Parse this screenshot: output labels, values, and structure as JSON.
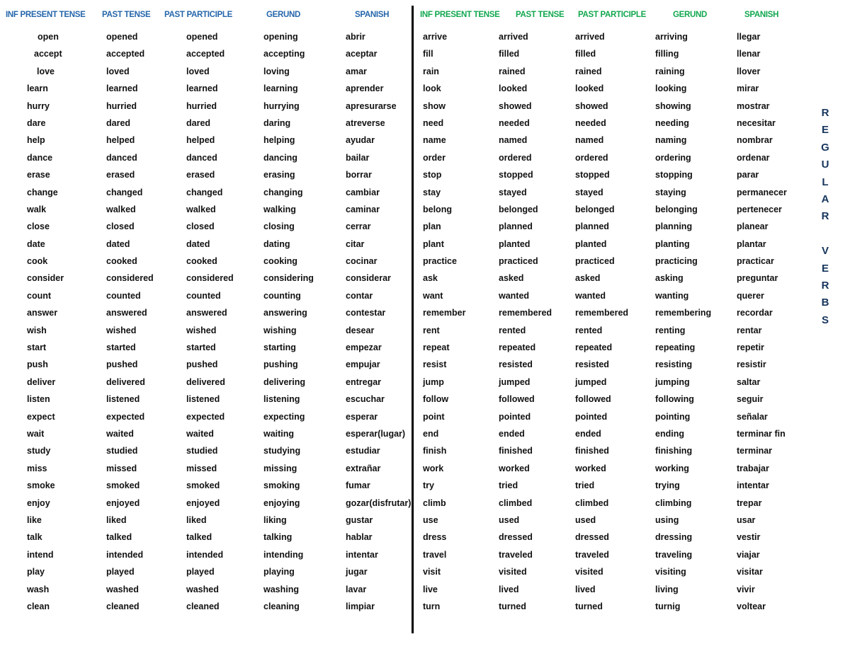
{
  "side_title": {
    "name": "regular-verbs-vertical-title",
    "letters": [
      "R",
      "E",
      "G",
      "U",
      "L",
      "A",
      "R",
      "",
      "V",
      "E",
      "R",
      "B",
      "S"
    ]
  },
  "colors": {
    "left_header": "#2566ab",
    "right_header": "#12a84f",
    "side_title": "#17365d",
    "body_text": "#111111",
    "divider": "#000000",
    "background": "#ffffff"
  },
  "left_table": {
    "headers": [
      "INF PRESENT TENSE",
      "PAST TENSE",
      "PAST PARTICIPLE",
      "GERUND",
      "SPANISH"
    ],
    "rows": [
      [
        "open",
        "opened",
        "opened",
        "opening",
        "abrir"
      ],
      [
        "accept",
        "accepted",
        "accepted",
        "accepting",
        "aceptar"
      ],
      [
        "love",
        "loved",
        "loved",
        "loving",
        "amar"
      ],
      [
        "learn",
        "learned",
        "learned",
        "learning",
        "aprender"
      ],
      [
        "hurry",
        "hurried",
        "hurried",
        "hurrying",
        "apresurarse"
      ],
      [
        "dare",
        "dared",
        "dared",
        "daring",
        "atreverse"
      ],
      [
        "help",
        "helped",
        "helped",
        "helping",
        "ayudar"
      ],
      [
        "dance",
        "danced",
        "danced",
        "dancing",
        "bailar"
      ],
      [
        "erase",
        "erased",
        "erased",
        "erasing",
        "borrar"
      ],
      [
        "change",
        "changed",
        "changed",
        "changing",
        "cambiar"
      ],
      [
        "walk",
        "walked",
        "walked",
        "walking",
        "caminar"
      ],
      [
        "close",
        "closed",
        "closed",
        "closing",
        "cerrar"
      ],
      [
        "date",
        "dated",
        "dated",
        "dating",
        "citar"
      ],
      [
        "cook",
        "cooked",
        "cooked",
        "cooking",
        "cocinar"
      ],
      [
        "consider",
        "considered",
        "considered",
        "considering",
        "considerar"
      ],
      [
        "count",
        "counted",
        "counted",
        "counting",
        "contar"
      ],
      [
        "answer",
        "answered",
        "answered",
        "answering",
        "contestar"
      ],
      [
        "wish",
        "wished",
        "wished",
        "wishing",
        "desear"
      ],
      [
        "start",
        "started",
        "started",
        "starting",
        "empezar"
      ],
      [
        "push",
        "pushed",
        "pushed",
        "pushing",
        "empujar"
      ],
      [
        "deliver",
        "delivered",
        "delivered",
        "delivering",
        "entregar"
      ],
      [
        "listen",
        "listened",
        "listened",
        "listening",
        "escuchar"
      ],
      [
        "expect",
        "expected",
        "expected",
        "expecting",
        "esperar"
      ],
      [
        "wait",
        "waited",
        "waited",
        "waiting",
        "esperar(lugar)"
      ],
      [
        "study",
        "studied",
        "studied",
        "studying",
        "estudiar"
      ],
      [
        "miss",
        "missed",
        "missed",
        "missing",
        "extrañar"
      ],
      [
        "smoke",
        "smoked",
        "smoked",
        "smoking",
        "fumar"
      ],
      [
        "enjoy",
        "enjoyed",
        "enjoyed",
        "enjoying",
        "gozar(disfrutar)"
      ],
      [
        "like",
        "liked",
        "liked",
        "liking",
        "gustar"
      ],
      [
        "talk",
        "talked",
        "talked",
        "talking",
        "hablar"
      ],
      [
        "intend",
        "intended",
        "intended",
        "intending",
        "intentar"
      ],
      [
        "play",
        "played",
        "played",
        "playing",
        "jugar"
      ],
      [
        "wash",
        "washed",
        "washed",
        "washing",
        "lavar"
      ],
      [
        "clean",
        "cleaned",
        "cleaned",
        "cleaning",
        "limpiar"
      ]
    ]
  },
  "right_table": {
    "headers": [
      "INF PRESENT TENSE",
      "PAST TENSE",
      "PAST PARTICIPLE",
      "GERUND",
      "SPANISH"
    ],
    "rows": [
      [
        "arrive",
        "arrived",
        "arrived",
        "arriving",
        "llegar"
      ],
      [
        "fill",
        "filled",
        "filled",
        "filling",
        "llenar"
      ],
      [
        "rain",
        "rained",
        "rained",
        "raining",
        "llover"
      ],
      [
        "look",
        "looked",
        "looked",
        "looking",
        "mirar"
      ],
      [
        "show",
        "showed",
        "showed",
        "showing",
        "mostrar"
      ],
      [
        "need",
        "needed",
        "needed",
        "needing",
        "necesitar"
      ],
      [
        "name",
        "named",
        "named",
        "naming",
        "nombrar"
      ],
      [
        "order",
        "ordered",
        "ordered",
        "ordering",
        "ordenar"
      ],
      [
        "stop",
        "stopped",
        "stopped",
        "stopping",
        "parar"
      ],
      [
        "stay",
        "stayed",
        "stayed",
        "staying",
        "permanecer"
      ],
      [
        "belong",
        "belonged",
        "belonged",
        "belonging",
        "pertenecer"
      ],
      [
        "plan",
        "planned",
        "planned",
        "planning",
        "planear"
      ],
      [
        "plant",
        "planted",
        "planted",
        "planting",
        "plantar"
      ],
      [
        "practice",
        "practiced",
        "practiced",
        "practicing",
        "practicar"
      ],
      [
        "ask",
        "asked",
        "asked",
        "asking",
        "preguntar"
      ],
      [
        "want",
        "wanted",
        "wanted",
        "wanting",
        "querer"
      ],
      [
        "remember",
        "remembered",
        "remembered",
        "remembering",
        "recordar"
      ],
      [
        "rent",
        "rented",
        "rented",
        "renting",
        "rentar"
      ],
      [
        "repeat",
        "repeated",
        "repeated",
        "repeating",
        "repetir"
      ],
      [
        "resist",
        "resisted",
        "resisted",
        "resisting",
        "resistir"
      ],
      [
        "jump",
        "jumped",
        "jumped",
        "jumping",
        "saltar"
      ],
      [
        "follow",
        "followed",
        "followed",
        "following",
        "seguir"
      ],
      [
        "point",
        "pointed",
        "pointed",
        "pointing",
        "señalar"
      ],
      [
        "end",
        "ended",
        "ended",
        "ending",
        "terminar fin"
      ],
      [
        "finish",
        "finished",
        "finished",
        "finishing",
        "terminar"
      ],
      [
        "work",
        "worked",
        "worked",
        "working",
        "trabajar"
      ],
      [
        "try",
        "tried",
        "tried",
        "trying",
        "intentar"
      ],
      [
        "climb",
        "climbed",
        "climbed",
        "climbing",
        "trepar"
      ],
      [
        "use",
        "used",
        "used",
        "using",
        "usar"
      ],
      [
        "dress",
        "dressed",
        "dressed",
        "dressing",
        "vestir"
      ],
      [
        "travel",
        "traveled",
        "traveled",
        "traveling",
        "viajar"
      ],
      [
        "visit",
        "visited",
        "visited",
        "visiting",
        "visitar"
      ],
      [
        "live",
        "lived",
        "lived",
        "living",
        "vivir"
      ],
      [
        "turn",
        "turned",
        "turned",
        "turnig",
        "voltear"
      ]
    ]
  }
}
